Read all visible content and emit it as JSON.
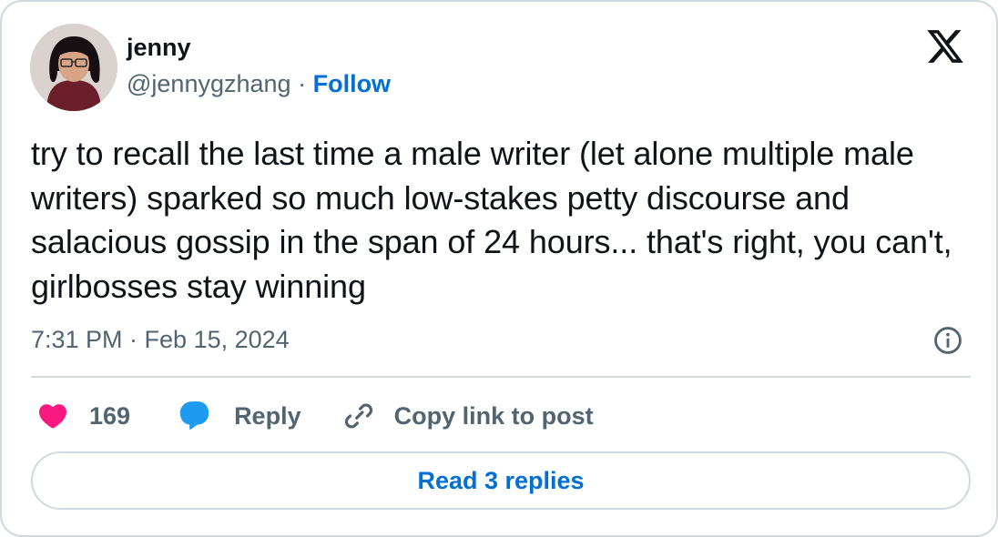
{
  "author": {
    "name": "jenny",
    "handle": "@jennygzhang",
    "separator": "·",
    "follow_label": "Follow"
  },
  "logo": {
    "icon": "x-logo-icon"
  },
  "tweet": {
    "text": "try to recall the last time a male writer (let alone multiple male writers) sparked so much low-stakes petty discourse and salacious gossip in the span of 24 hours... that's right, you can't, girlbosses stay winning",
    "timestamp": "7:31 PM · Feb 15, 2024"
  },
  "actions": {
    "likes_count": "169",
    "reply_label": "Reply",
    "copy_link_label": "Copy link to post"
  },
  "read_replies_label": "Read 3 replies",
  "colors": {
    "like": "#f91880",
    "reply": "#1d9bf0",
    "link": "#006fd6",
    "muted": "#536471",
    "border": "#cfd9de"
  }
}
